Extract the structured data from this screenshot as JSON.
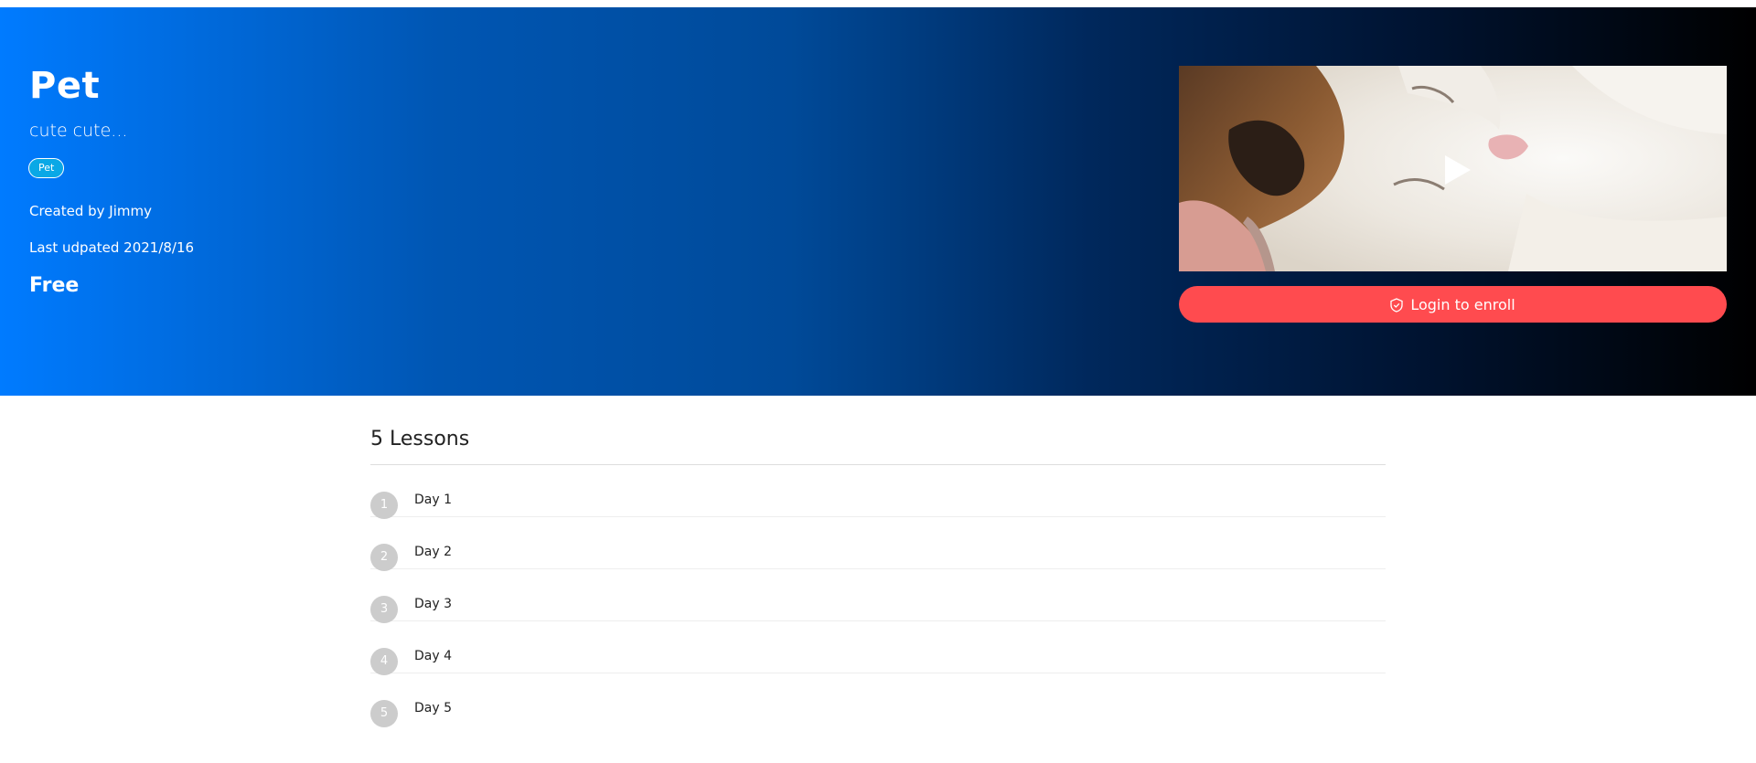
{
  "course": {
    "title": "Pet",
    "subtitle": "cute cute...",
    "tag": "Pet",
    "created_by": "Created by Jimmy",
    "last_updated": "Last udpated 2021/8/16",
    "price": "Free"
  },
  "video": {
    "icon": "play-icon"
  },
  "enroll": {
    "label": "Login to enroll",
    "icon": "shield-check-icon",
    "color": "#ff4b4f"
  },
  "lessons": {
    "heading": "5 Lessons",
    "items": [
      {
        "number": "1",
        "title": "Day 1"
      },
      {
        "number": "2",
        "title": "Day 2"
      },
      {
        "number": "3",
        "title": "Day 3"
      },
      {
        "number": "4",
        "title": "Day 4"
      },
      {
        "number": "5",
        "title": "Day 5"
      }
    ]
  },
  "colors": {
    "hero_start": "#007bff",
    "hero_end": "#000000",
    "number_badge": "#cccccc"
  }
}
